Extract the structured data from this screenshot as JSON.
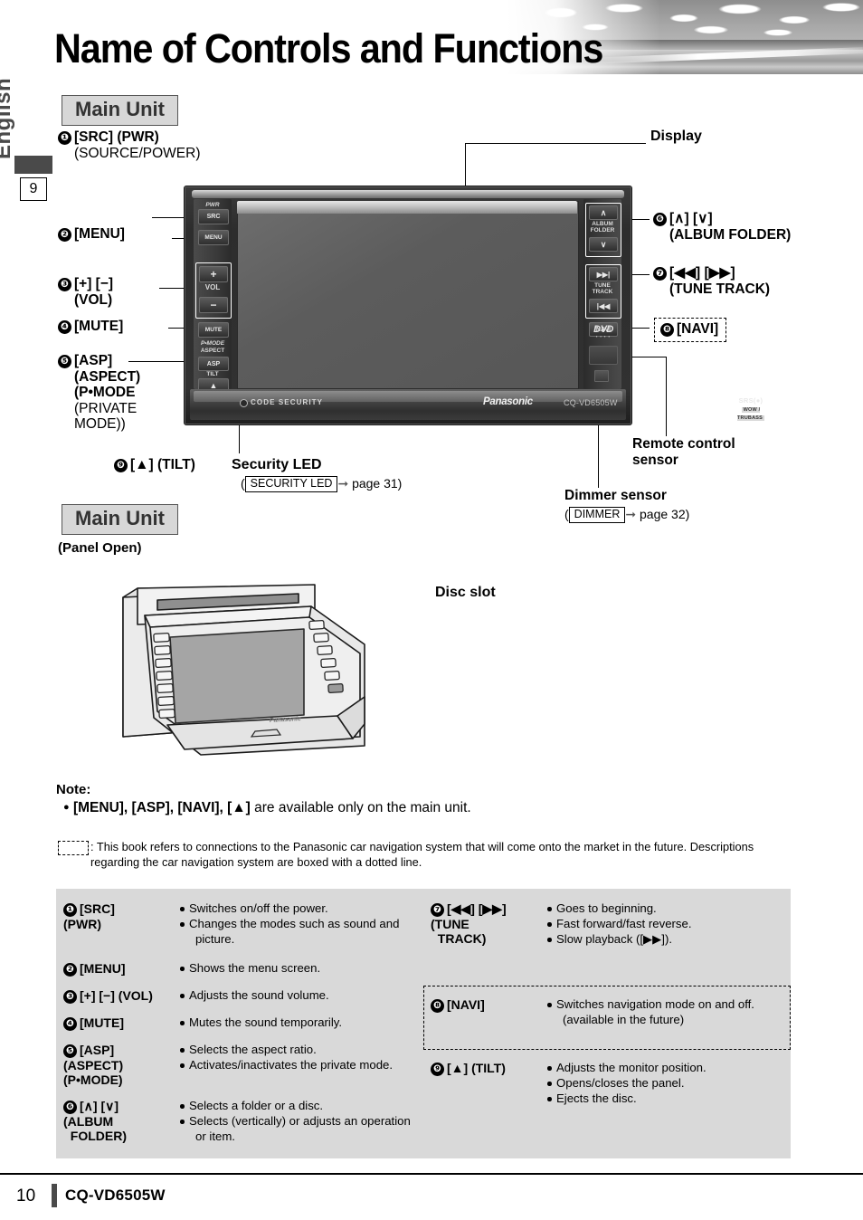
{
  "page": {
    "title": "Name of Controls and Functions",
    "language_tab": "English",
    "chapter_number": "9",
    "footer_page_number": "10",
    "footer_model": "CQ-VD6505W"
  },
  "sections": {
    "main_unit_heading": "Main Unit",
    "main_unit_open_heading": "Main Unit",
    "panel_open_subtitle": "(Panel Open)"
  },
  "callouts": {
    "left": [
      {
        "num": "❶",
        "label": "[SRC] (PWR)",
        "sub": "(SOURCE/POWER)"
      },
      {
        "num": "❷",
        "label": "[MENU]",
        "sub": ""
      },
      {
        "num": "❸",
        "label": "[+] [−]",
        "sub": "(VOL)"
      },
      {
        "num": "❹",
        "label": "[MUTE]",
        "sub": ""
      },
      {
        "num": "❺",
        "label": "[ASP]",
        "sub": "(ASPECT)"
      }
    ],
    "asp_extra_1": "(P•MODE",
    "asp_extra_2": "(PRIVATE",
    "asp_extra_3": "MODE))",
    "tilt": {
      "num": "❾",
      "label": "[▲] (TILT)"
    },
    "right": [
      {
        "num": "❻",
        "label": "[∧] [∨]",
        "sub": "(ALBUM FOLDER)"
      },
      {
        "num": "❼",
        "label": "[◀◀] [▶▶]",
        "sub": "(TUNE TRACK)"
      },
      {
        "num": "❽",
        "label": "[NAVI]",
        "sub": ""
      }
    ],
    "display": "Display",
    "remote_control_sensor": "Remote control\nsensor",
    "remote_control_sensor_l1": "Remote control",
    "remote_control_sensor_l2": "sensor",
    "dimmer_sensor": "Dimmer sensor",
    "dimmer_ref_box": "DIMMER",
    "dimmer_ref_page": "page 32",
    "security_led": "Security LED",
    "security_ref_box": "SECURITY LED",
    "security_ref_page": "page 31",
    "disc_slot": "Disc slot"
  },
  "device": {
    "buttons_left": [
      {
        "top_label": "PWR",
        "face": "SRC"
      },
      {
        "top_label": "",
        "face": "MENU"
      },
      {
        "top_label": "",
        "face": "+"
      },
      {
        "top_label": "",
        "face": "VOL"
      },
      {
        "top_label": "",
        "face": "−"
      },
      {
        "top_label": "",
        "face": "MUTE"
      },
      {
        "top_label": "P•MODE",
        "face": ""
      },
      {
        "top_label": "ASPECT",
        "face": "ASP"
      },
      {
        "top_label": "TILT",
        "face": "▲"
      }
    ],
    "vol_label": "VOL",
    "buttons_right": [
      {
        "face": "∧"
      },
      {
        "top_label": "ALBUM"
      },
      {
        "top_label": "FOLDER"
      },
      {
        "face": "∨"
      },
      {
        "face": "▶▶|"
      },
      {
        "top_label": "TUNE"
      },
      {
        "top_label": "TRACK"
      },
      {
        "face": "|◀◀"
      },
      {
        "face": "NAVI"
      }
    ],
    "album_label_1": "ALBUM",
    "album_label_2": "FOLDER",
    "tune_label_1": "TUNE",
    "tune_label_2": "TRACK",
    "navi_label": "NAVI",
    "dvd_logo": "DVD",
    "dvd_sub": "▪ ▪ ▪ ▪",
    "code_security": "CODE SECURITY",
    "brand": "Panasonic",
    "model": "CQ-VD6505W",
    "srs_line1": "SRS(●)",
    "srs_line2": "WOW / TRUBASS"
  },
  "note": {
    "title": "Note:",
    "bullet_bold": "[MENU], [ASP], [NAVI], [▲]",
    "bullet_rest": " are available only on the main unit.",
    "dotted_legend_text": ": This book refers to connections to the Panasonic car navigation system that will come onto the market in the future. Descriptions regarding the car navigation system are boxed with a dotted line."
  },
  "table": {
    "left_rows": [
      {
        "num": "❶",
        "key_lines": [
          "[SRC]",
          "(PWR)"
        ],
        "values": [
          "Switches on/off the power.",
          "Changes the modes such as sound and",
          "picture."
        ],
        "value_flags": [
          true,
          true,
          false
        ]
      },
      {
        "num": "❷",
        "key_lines": [
          "[MENU]"
        ],
        "values": [
          "Shows the menu screen."
        ],
        "value_flags": [
          true
        ]
      },
      {
        "num": "❸",
        "key_lines": [
          "[+] [−] (VOL)"
        ],
        "values": [
          "Adjusts the sound volume."
        ],
        "value_flags": [
          true
        ]
      },
      {
        "num": "❹",
        "key_lines": [
          "[MUTE]"
        ],
        "values": [
          "Mutes the sound temporarily."
        ],
        "value_flags": [
          true
        ]
      },
      {
        "num": "❺",
        "key_lines": [
          "[ASP]",
          "(ASPECT)",
          "(P•MODE)"
        ],
        "values": [
          "Selects the aspect ratio.",
          "Activates/inactivates the private mode."
        ],
        "value_flags": [
          true,
          true
        ]
      },
      {
        "num": "❻",
        "key_lines": [
          "[∧] [∨]",
          "(ALBUM",
          "  FOLDER)"
        ],
        "values": [
          "Selects a folder or a disc.",
          "Selects (vertically) or adjusts an operation",
          "or item."
        ],
        "value_flags": [
          true,
          true,
          false
        ]
      }
    ],
    "right_rows": [
      {
        "num": "❼",
        "key_lines": [
          "[◀◀] [▶▶]",
          "(TUNE",
          "  TRACK)"
        ],
        "values": [
          "Goes to beginning.",
          "Fast forward/fast reverse.",
          "Slow playback ([▶▶])."
        ],
        "value_flags": [
          true,
          true,
          true
        ]
      },
      {
        "num": "❽",
        "key_lines": [
          "[NAVI]"
        ],
        "values": [
          "Switches navigation mode on and off.",
          "(available in the future)"
        ],
        "value_flags": [
          true,
          false
        ],
        "dashed": true
      },
      {
        "num": "❾",
        "key_lines": [
          "[▲] (TILT)"
        ],
        "values": [
          "Adjusts the monitor position.",
          "Opens/closes the panel.",
          "Ejects the disc."
        ],
        "value_flags": [
          true,
          true,
          true
        ]
      }
    ]
  }
}
